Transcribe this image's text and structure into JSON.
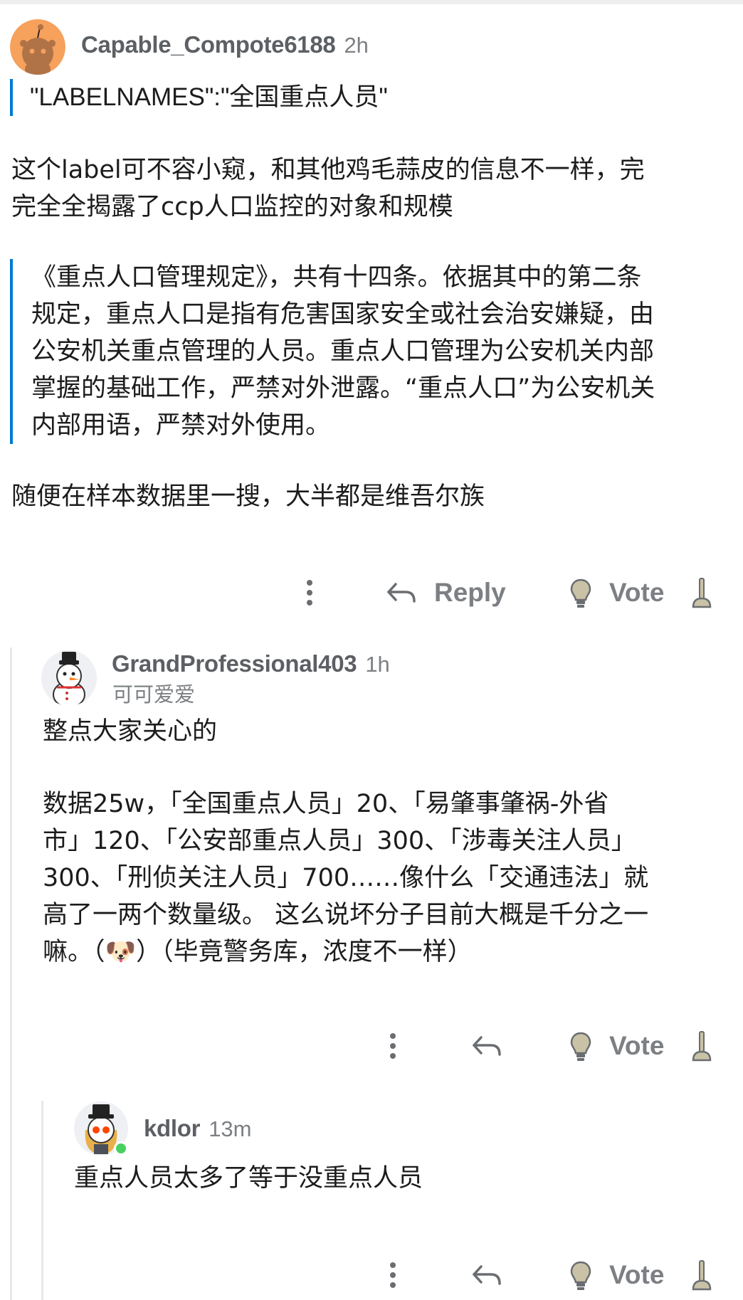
{
  "comments": {
    "top": {
      "username": "Capable_Compote6188",
      "time": "2h",
      "quote1": "\"LABELNAMES\":\"全国重点人员\"",
      "paragraph1": [
        "这个label可不容小窥，和其他鸡毛蒜皮的信息不一样，完",
        "完全全揭露了ccp人口监控的对象和规模"
      ],
      "quote2": [
        "《重点人口管理规定》，共有十四条。依据其中的第二条",
        "规定，重点人口是指有危害国家安全或社会治安嫌疑，由",
        "公安机关重点管理的人员。重点人口管理为公安机关内部",
        "掌握的基础工作，严禁对外泄露。“重点人口”为公安机关",
        "内部用语，严禁对外使用。"
      ],
      "paragraph2": "随便在样本数据里一搜，大半都是维吾尔族",
      "reply_label": "Reply",
      "vote_label": "Vote",
      "avatar_icon": "reddit-snoo-orange-avatar"
    },
    "reply1": {
      "username": "GrandProfessional403",
      "time": "1h",
      "flair": "可可爱爱",
      "paragraph1": "整点大家关心的",
      "paragraph2": [
        "数据25w，「全国重点人员」20、「易肇事肇祸-外省",
        "市」120、「公安部重点人员」300、「涉毒关注人员」",
        "300、「刑侦关注人员」700……像什么「交通违法」就",
        "高了一两个数量级。 这么说坏分子目前大概是千分之一",
        "嘛。（🐶）（毕竟警务库，浓度不一样）"
      ],
      "vote_label": "Vote",
      "avatar_icon": "snowman-top-hat-avatar"
    },
    "reply2": {
      "username": "kdlor",
      "time": "13m",
      "paragraph1": "重点人员太多了等于没重点人员",
      "vote_label": "Vote",
      "avatar_icon": "snoo-top-hat-avatar",
      "online": true
    }
  },
  "colors": {
    "quote_bar": "#0079d3",
    "meta_text": "#7c7f83",
    "online_dot": "#46d160",
    "avatar_orange": "#f6a15c"
  }
}
